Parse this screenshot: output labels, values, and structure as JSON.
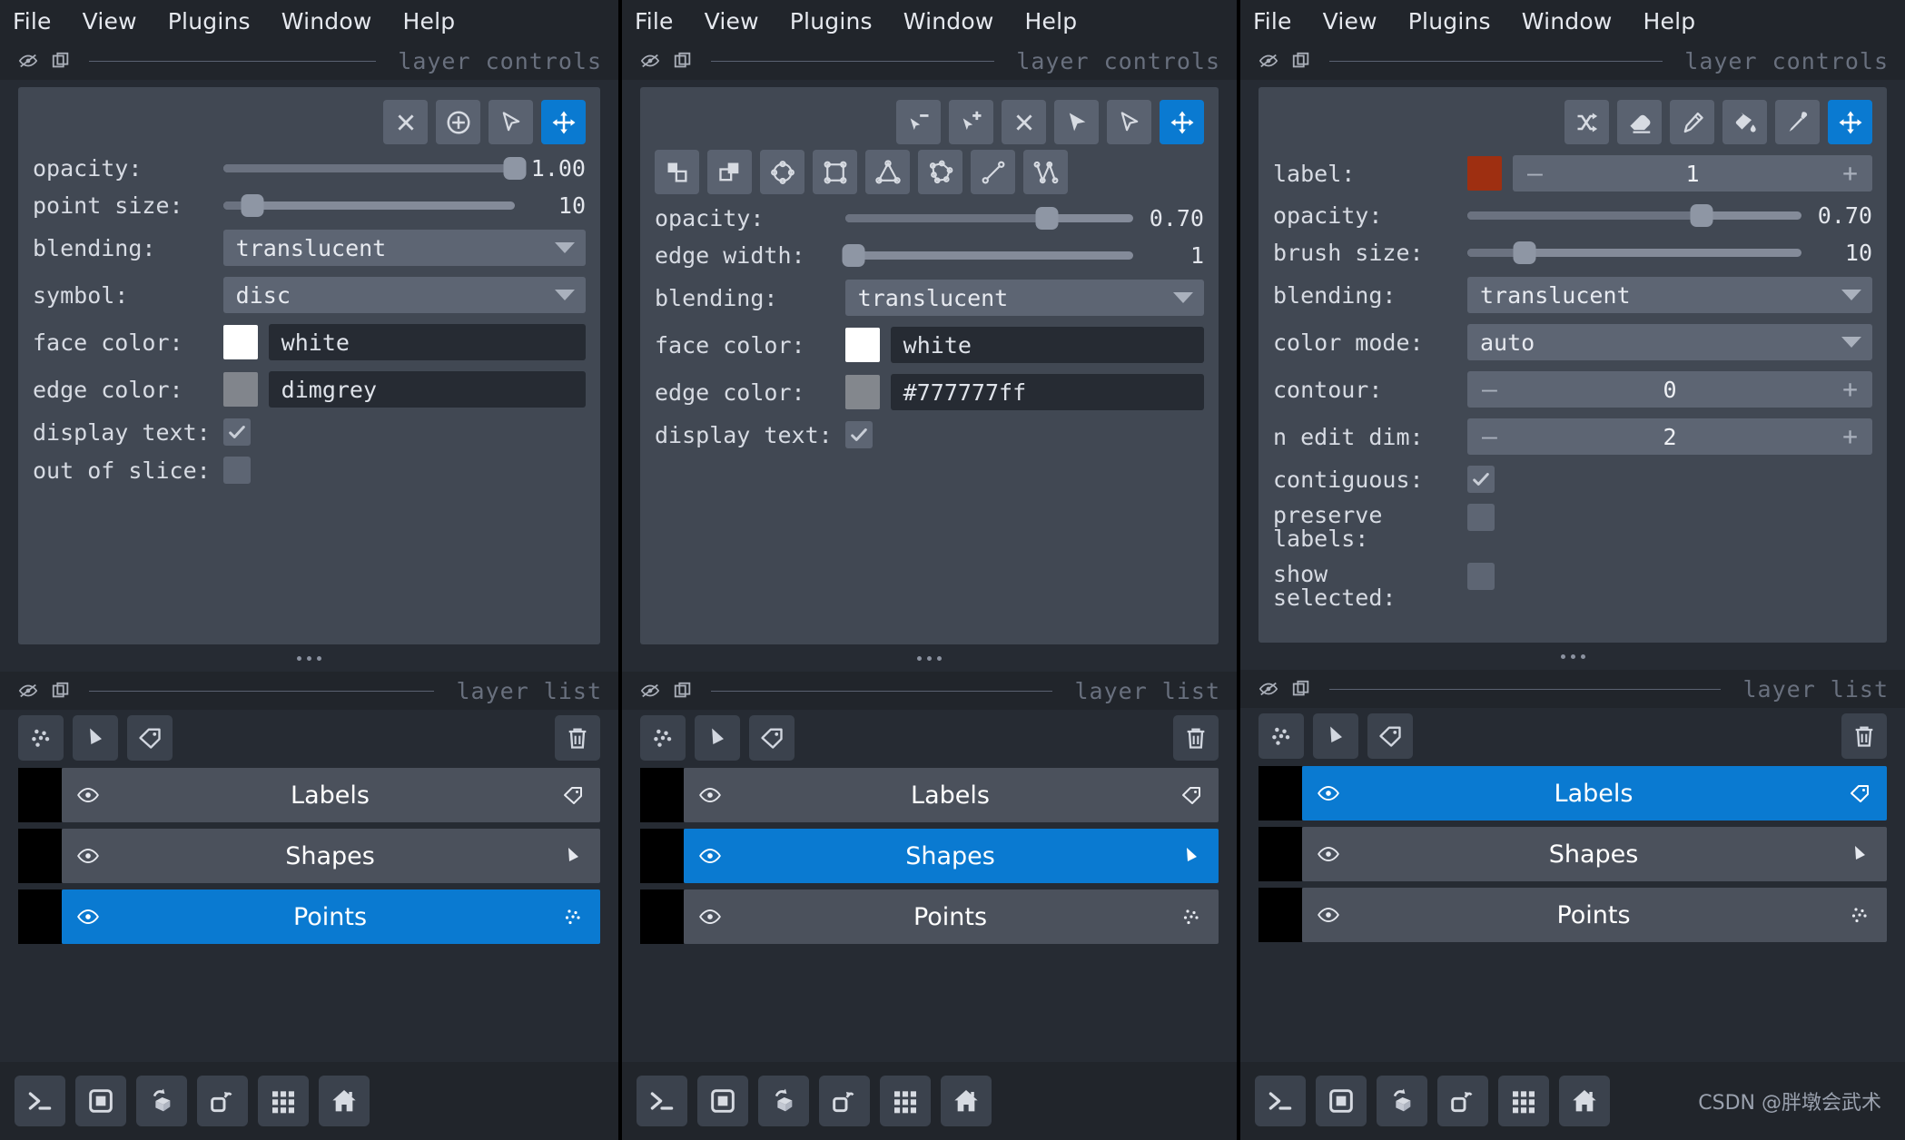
{
  "app": {
    "watermark": "CSDN @胖墩会武术"
  },
  "menu": {
    "items": [
      "File",
      "View",
      "Plugins",
      "Window",
      "Help"
    ]
  },
  "section_titles": {
    "layer_controls": "layer controls",
    "layer_list": "layer list"
  },
  "panels": [
    {
      "id": "points",
      "tools_row1": [
        {
          "name": "delete-selected-points-button",
          "icon": "close-icon",
          "active": false
        },
        {
          "name": "add-points-button",
          "icon": "plus-circle-icon",
          "active": false
        },
        {
          "name": "select-points-button",
          "icon": "cursor-arrow-icon",
          "active": false
        },
        {
          "name": "pan-zoom-button",
          "icon": "move-icon",
          "active": true
        }
      ],
      "tools_row2": [],
      "controls": {
        "opacity": {
          "label": "opacity:",
          "value": "1.00",
          "percent": 100
        },
        "point_size": {
          "label": "point size:",
          "value": "10",
          "percent": 10
        },
        "blending": {
          "label": "blending:",
          "value": "translucent"
        },
        "symbol": {
          "label": "symbol:",
          "value": "disc"
        },
        "face_color": {
          "label": "face color:",
          "value": "white",
          "swatch": "#ffffff"
        },
        "edge_color": {
          "label": "edge color:",
          "value": "dimgrey",
          "swatch": "#81858c"
        },
        "display_text": {
          "label": "display text:",
          "checked": true
        },
        "out_of_slice": {
          "label": "out of slice:",
          "checked": false
        }
      },
      "selected_layer": "Points"
    },
    {
      "id": "shapes",
      "tools_row1": [
        {
          "name": "select-vertex-remove-button",
          "icon": "vertex-remove-icon",
          "active": false
        },
        {
          "name": "select-vertex-insert-button",
          "icon": "vertex-insert-icon",
          "active": false
        },
        {
          "name": "delete-shape-button",
          "icon": "close-icon",
          "active": false
        },
        {
          "name": "direct-select-button",
          "icon": "cursor-filled-icon",
          "active": false
        },
        {
          "name": "select-shapes-button",
          "icon": "cursor-arrow-icon",
          "active": false
        },
        {
          "name": "pan-zoom-button",
          "icon": "move-icon",
          "active": true
        }
      ],
      "tools_row2": [
        {
          "name": "move-to-front-button",
          "icon": "shapes-front-icon",
          "active": false
        },
        {
          "name": "move-to-back-button",
          "icon": "shapes-back-icon",
          "active": false
        },
        {
          "name": "add-ellipse-button",
          "icon": "ellipse-icon",
          "active": false
        },
        {
          "name": "add-rectangle-button",
          "icon": "rectangle-icon",
          "active": false
        },
        {
          "name": "add-polygon-button",
          "icon": "triangle-icon",
          "active": false
        },
        {
          "name": "add-polygon-lasso-button",
          "icon": "polygon-icon",
          "active": false
        },
        {
          "name": "add-line-button",
          "icon": "line-icon",
          "active": false
        },
        {
          "name": "add-path-button",
          "icon": "path-icon",
          "active": false
        }
      ],
      "controls": {
        "opacity": {
          "label": "opacity:",
          "value": "0.70",
          "percent": 70
        },
        "edge_width": {
          "label": "edge width:",
          "value": "1",
          "percent": 3
        },
        "blending": {
          "label": "blending:",
          "value": "translucent"
        },
        "face_color": {
          "label": "face color:",
          "value": "white",
          "swatch": "#ffffff"
        },
        "edge_color": {
          "label": "edge color:",
          "value": "#777777ff",
          "swatch": "#83878d"
        },
        "display_text": {
          "label": "display text:",
          "checked": true
        }
      },
      "selected_layer": "Shapes"
    },
    {
      "id": "labels",
      "tools_row1": [
        {
          "name": "shuffle-colors-button",
          "icon": "shuffle-icon",
          "active": false
        },
        {
          "name": "eraser-button",
          "icon": "eraser-icon",
          "active": false
        },
        {
          "name": "paint-brush-button",
          "icon": "paintbrush-icon",
          "active": false
        },
        {
          "name": "fill-bucket-button",
          "icon": "fill-bucket-icon",
          "active": false
        },
        {
          "name": "color-picker-button",
          "icon": "eyedropper-icon",
          "active": false
        },
        {
          "name": "pan-zoom-button",
          "icon": "move-icon",
          "active": true
        }
      ],
      "tools_row2": [],
      "controls": {
        "label": {
          "label": "label:",
          "value": "1",
          "swatch": "#9e2f11",
          "minus": "–",
          "plus": "+"
        },
        "opacity": {
          "label": "opacity:",
          "value": "0.70",
          "percent": 70
        },
        "brush_size": {
          "label": "brush size:",
          "value": "10",
          "percent": 17
        },
        "blending": {
          "label": "blending:",
          "value": "translucent"
        },
        "color_mode": {
          "label": "color mode:",
          "value": "auto"
        },
        "contour": {
          "label": "contour:",
          "value": "0",
          "minus": "–",
          "plus": "+"
        },
        "n_edit_dim": {
          "label": "n edit dim:",
          "value": "2",
          "minus": "–",
          "plus": "+"
        },
        "contiguous": {
          "label": "contiguous:",
          "checked": true
        },
        "preserve_labels": {
          "label": "preserve labels:",
          "checked": false
        },
        "show_selected": {
          "label": "show selected:",
          "checked": false
        }
      },
      "selected_layer": "Labels"
    }
  ],
  "layer_list": {
    "add_buttons": [
      {
        "name": "new-points-layer-button",
        "icon": "points-icon"
      },
      {
        "name": "new-shapes-layer-button",
        "icon": "shapes-icon"
      },
      {
        "name": "new-labels-layer-button",
        "icon": "labels-icon"
      }
    ],
    "delete_button": {
      "name": "delete-layer-button",
      "icon": "trash-icon"
    },
    "layers": [
      {
        "name": "Labels",
        "icon": "labels-icon"
      },
      {
        "name": "Shapes",
        "icon": "shapes-icon"
      },
      {
        "name": "Points",
        "icon": "points-icon"
      }
    ]
  },
  "statusbar": {
    "buttons": [
      {
        "name": "console-button",
        "icon": "console-icon"
      },
      {
        "name": "ndisplay-toggle-button",
        "icon": "square-3d-icon"
      },
      {
        "name": "roll-dims-button",
        "icon": "roll-dims-icon"
      },
      {
        "name": "transpose-dims-button",
        "icon": "transpose-dims-icon"
      },
      {
        "name": "grid-view-button",
        "icon": "grid-icon"
      },
      {
        "name": "home-button",
        "icon": "home-icon"
      }
    ]
  }
}
